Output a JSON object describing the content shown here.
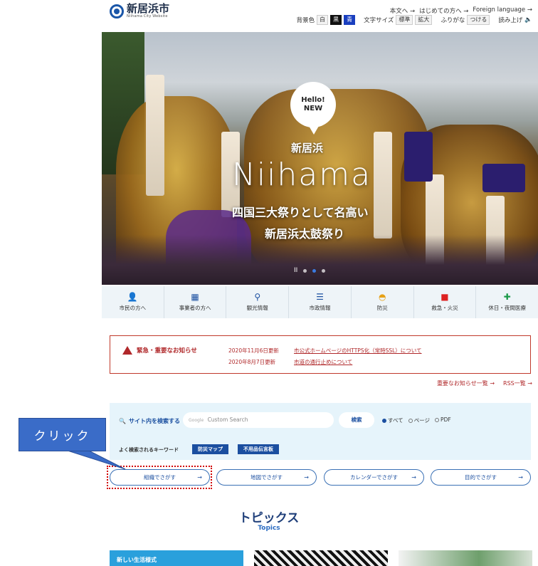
{
  "header": {
    "site_title": "新居浜市",
    "site_subtitle": "Niihama City Website",
    "links": [
      "本文へ →",
      "はじめての方へ →",
      "Foreign language →"
    ],
    "bgcolor_label": "背景色",
    "bgcolor_options": [
      "白",
      "黒",
      "青"
    ],
    "fontsize_label": "文字サイズ",
    "fontsize_options": [
      "標準",
      "拡大"
    ],
    "furigana_label": "ふりがな",
    "furigana_button": "つける",
    "readaloud_label": "読み上げ"
  },
  "hero": {
    "bubble_line1": "Hello!",
    "bubble_line2": "NEW",
    "kanji": "新居浜",
    "name": "Niihama",
    "line1": "四国三大祭りとして名高い",
    "line2": "新居浜太鼓祭り",
    "pause": "II"
  },
  "categories": [
    {
      "label": "市民の方へ",
      "icon": "person-icon"
    },
    {
      "label": "事業者の方へ",
      "icon": "building-icon"
    },
    {
      "label": "観光情報",
      "icon": "map-pin-icon"
    },
    {
      "label": "市政情報",
      "icon": "list-icon"
    },
    {
      "label": "防災",
      "icon": "helmet-icon"
    },
    {
      "label": "救急・火災",
      "icon": "ambulance-icon"
    },
    {
      "label": "休日・夜間医療",
      "icon": "first-aid-icon"
    }
  ],
  "emergency": {
    "heading": "緊急・重要なお知らせ",
    "items": [
      {
        "date": "2020年11月6日更新",
        "title": "市公式ホームページのHTTPS化（常時SSL）について"
      },
      {
        "date": "2020年8月7日更新",
        "title": "市道の通行止めについて"
      }
    ],
    "more_link": "重要なお知らせ一覧 →",
    "rss_link": "RSS一覧 →"
  },
  "search": {
    "label": "サイト内を検索する",
    "google_label": "Google",
    "placeholder": "Custom Search",
    "button": "検索",
    "options": [
      "すべて",
      "ページ",
      "PDF"
    ],
    "selected_option": "すべて",
    "keywords_label": "よく検索されるキーワード",
    "keywords": [
      "防災マップ",
      "不用品伝言板"
    ]
  },
  "quick_buttons": [
    "組織でさがす",
    "地図でさがす",
    "カレンダーでさがす",
    "目的でさがす"
  ],
  "callout": {
    "text": "クリック"
  },
  "topics": {
    "title": "トピックス",
    "subtitle": "Topics",
    "card1_text": "新しい生活様式"
  },
  "colors": {
    "primary": "#1b4fa0",
    "emergency": "#b0282a",
    "callout": "#3a6cc8",
    "highlight": "#d10000"
  }
}
